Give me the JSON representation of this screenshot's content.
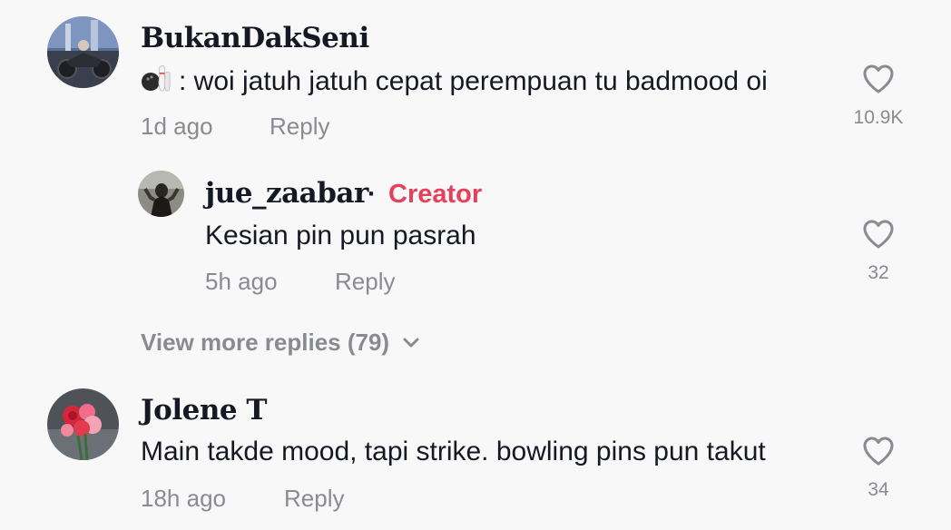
{
  "comments": [
    {
      "username": "BukanDakSeni",
      "emoji_icon": "bowling-icon",
      "text": ": woi jatuh jatuh cepat perempuan tu badmood oi",
      "time": "1d ago",
      "reply_label": "Reply",
      "likes": "10.9K",
      "reply": {
        "username": "jue_zaabar",
        "separator": "·",
        "badge": "Creator",
        "text": "Kesian pin pun pasrah",
        "time": "5h ago",
        "reply_label": "Reply",
        "likes": "32"
      },
      "view_more": "View more replies (79)"
    },
    {
      "username": "Jolene T",
      "text": "Main takde mood, tapi strike. bowling pins pun takut",
      "time": "18h ago",
      "reply_label": "Reply",
      "likes": "34"
    }
  ],
  "colors": {
    "background": "#f8f8f8",
    "creator_badge": "#e5415b",
    "muted_text": "#8a8b91",
    "primary_text": "#161823"
  }
}
